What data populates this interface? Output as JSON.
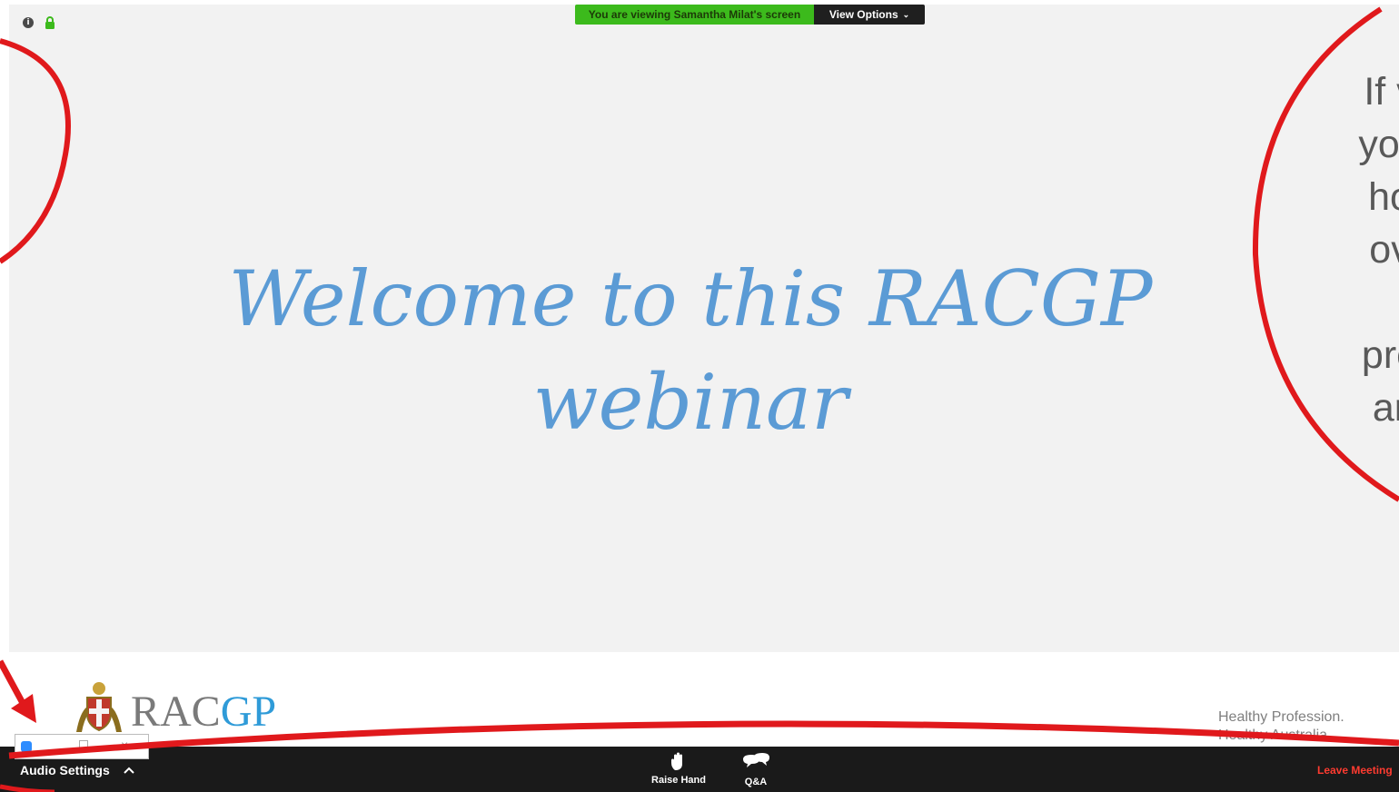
{
  "banner": {
    "viewing_text": "You are viewing Samantha Milat's screen",
    "view_options_label": "View Options",
    "chevron_icon": "chevron-down-icon"
  },
  "status_icons": {
    "info_icon": "info-icon",
    "lock_icon": "lock-icon"
  },
  "slide": {
    "title_line1": "Welcome to this RACGP",
    "title_line2": "webinar",
    "side_text": [
      "If v",
      "you",
      "ho",
      "ov",
      "",
      "pre",
      "ar"
    ],
    "logo_rac": "RAC",
    "logo_gp": "GP",
    "tagline_line1": "Healthy Profession.",
    "tagline_line2": "Healthy Australia."
  },
  "toolbar": {
    "audio_settings_label": "Audio Settings",
    "raise_hand_label": "Raise Hand",
    "qa_label": "Q&A",
    "leave_meeting_label": "Leave Meeting"
  },
  "colors": {
    "banner_green": "#3cba1c",
    "toolbar_bg": "#1a1a1a",
    "slide_title": "#5b9bd5",
    "leave_red": "#ff3b30",
    "annotation_red": "#e0191c"
  }
}
